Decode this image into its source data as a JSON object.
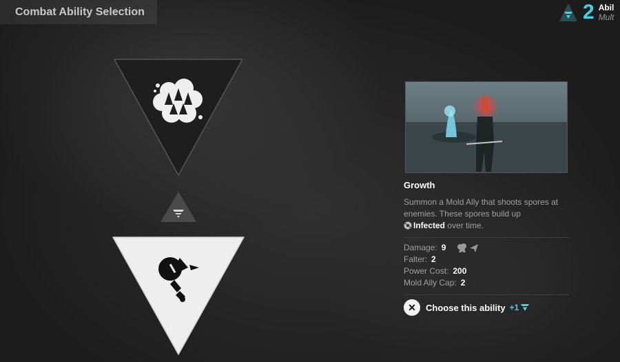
{
  "header": {
    "title": "Combat Ability Selection"
  },
  "points": {
    "count": "2",
    "label": "Abil",
    "sublabel": "Mult"
  },
  "slots": [
    {
      "state": "available",
      "icon": "spore-burst-icon"
    },
    {
      "state": "selected",
      "icon": "mold-ally-icon"
    }
  ],
  "ability": {
    "name": "Growth",
    "description_1": "Summon a Mold Ally that shoots spores at enemies. These spores build up",
    "status_name": "Infected",
    "description_2": "over time.",
    "stats": [
      {
        "label": "Damage:",
        "value": "9"
      },
      {
        "label": "Falter:",
        "value": "2"
      },
      {
        "label": "Power Cost:",
        "value": "200"
      },
      {
        "label": "Mold Ally Cap:",
        "value": "2"
      }
    ],
    "choose_label": "Choose this ability",
    "choose_bonus": "+1"
  },
  "colors": {
    "accent": "#3fd3e6",
    "selected_slot": "#eeeeee",
    "empty_slot": "#1e1e1e"
  }
}
